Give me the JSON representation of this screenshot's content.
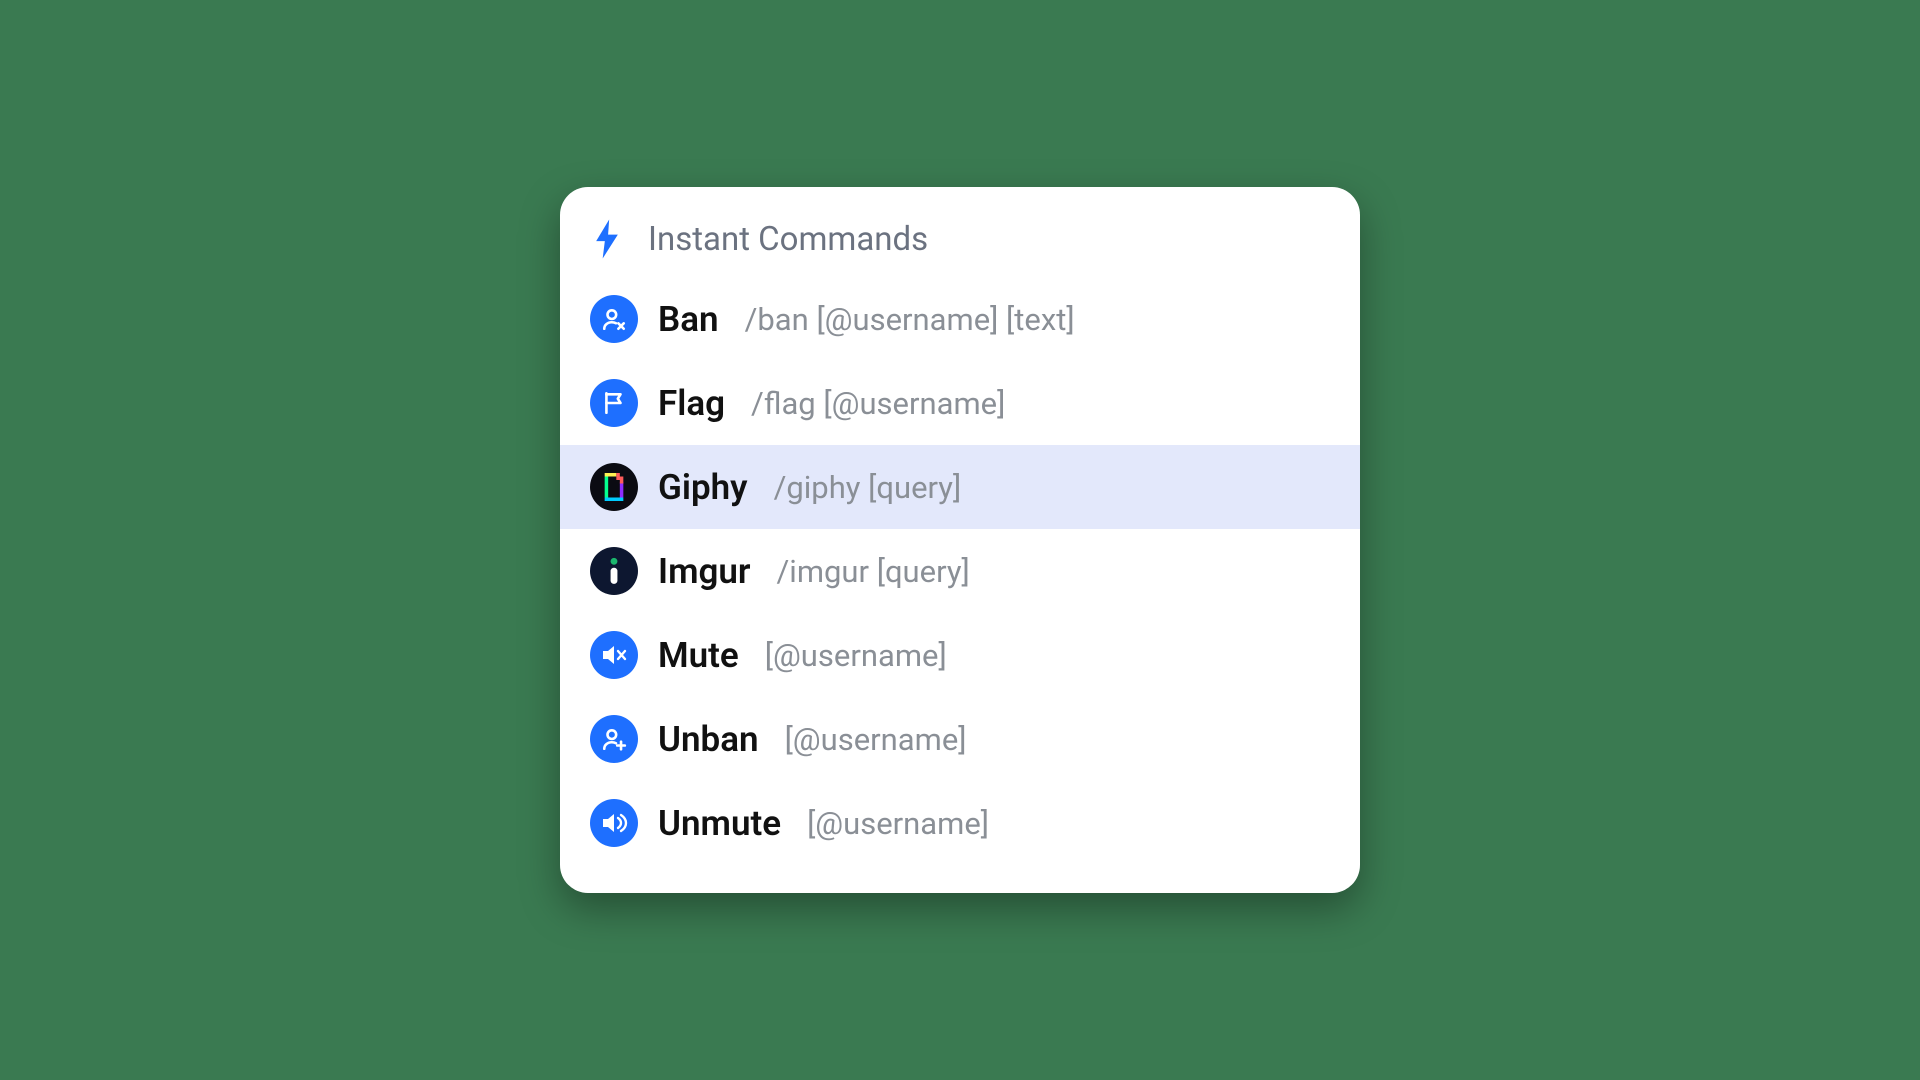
{
  "header": {
    "title": "Instant Commands"
  },
  "commands": [
    {
      "name": "Ban",
      "args": "/ban [@username] [text]",
      "icon": "user-x-icon",
      "iconClass": "icon-blue",
      "selected": false
    },
    {
      "name": "Flag",
      "args": "/flag [@username]",
      "icon": "flag-icon",
      "iconClass": "icon-blue",
      "selected": false
    },
    {
      "name": "Giphy",
      "args": "/giphy [query]",
      "icon": "giphy-icon",
      "iconClass": "icon-black",
      "selected": true
    },
    {
      "name": "Imgur",
      "args": "/imgur [query]",
      "icon": "imgur-icon",
      "iconClass": "icon-darknavy",
      "selected": false
    },
    {
      "name": "Mute",
      "args": "[@username]",
      "icon": "mute-icon",
      "iconClass": "icon-blue",
      "selected": false
    },
    {
      "name": "Unban",
      "args": "[@username]",
      "icon": "user-plus-icon",
      "iconClass": "icon-blue",
      "selected": false
    },
    {
      "name": "Unmute",
      "args": "[@username]",
      "icon": "unmute-icon",
      "iconClass": "icon-blue",
      "selected": false
    }
  ],
  "colors": {
    "accent": "#1e6fff",
    "background": "#3a7a51",
    "selectedRow": "#e3e8fb"
  }
}
